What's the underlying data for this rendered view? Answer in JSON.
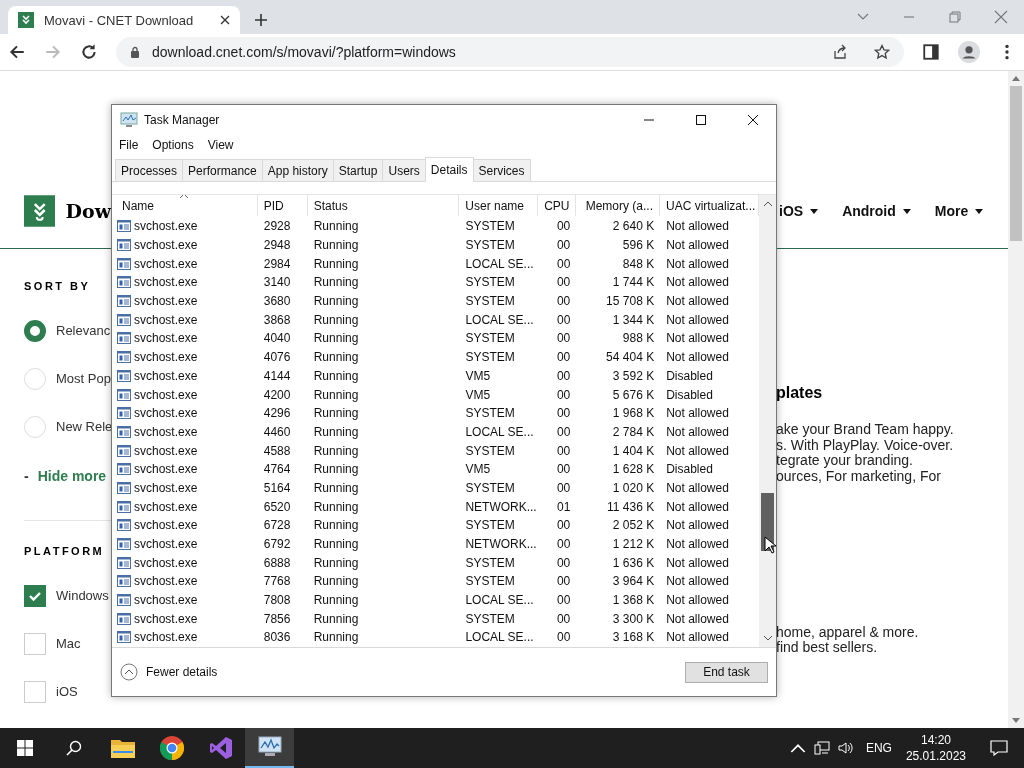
{
  "browser": {
    "tab": {
      "title": "Movavi - CNET Download"
    },
    "url": "download.cnet.com/s/movavi/?platform=windows"
  },
  "page": {
    "logo_text": "Dow",
    "nav": [
      "iOS",
      "Android",
      "More"
    ],
    "sort_by": {
      "heading": "SORT BY",
      "options": [
        {
          "label": "Relevanc",
          "selected": true
        },
        {
          "label": "Most Pop",
          "selected": false
        },
        {
          "label": "New Rele",
          "selected": false
        }
      ]
    },
    "toggle": {
      "sign": "-",
      "label": "Hide more"
    },
    "platform": {
      "heading": "PLATFORM",
      "options": [
        {
          "label": "Windows",
          "checked": true
        },
        {
          "label": "Mac",
          "checked": false
        },
        {
          "label": "iOS",
          "checked": false
        }
      ]
    },
    "promo_heading": "plates",
    "promo_lines": [
      "ake your Brand Team happy.",
      "s. With PlayPlay. Voice-over.",
      "tegrate your branding.",
      "ources, For marketing, For"
    ],
    "shop_lines": [
      "home, apparel & more.",
      "find best sellers."
    ]
  },
  "task_manager": {
    "title": "Task Manager",
    "menu": [
      "File",
      "Options",
      "View"
    ],
    "tabs": [
      {
        "label": "Processes",
        "selected": false
      },
      {
        "label": "Performance",
        "selected": false
      },
      {
        "label": "App history",
        "selected": false
      },
      {
        "label": "Startup",
        "selected": false
      },
      {
        "label": "Users",
        "selected": false
      },
      {
        "label": "Details",
        "selected": true
      },
      {
        "label": "Services",
        "selected": false
      }
    ],
    "columns": [
      "Name",
      "PID",
      "Status",
      "User name",
      "CPU",
      "Memory (a...",
      "UAC virtualizat..."
    ],
    "rows": [
      [
        "svchost.exe",
        "2928",
        "Running",
        "SYSTEM",
        "00",
        "2 640 K",
        "Not allowed"
      ],
      [
        "svchost.exe",
        "2948",
        "Running",
        "SYSTEM",
        "00",
        "596 K",
        "Not allowed"
      ],
      [
        "svchost.exe",
        "2984",
        "Running",
        "LOCAL SE...",
        "00",
        "848 K",
        "Not allowed"
      ],
      [
        "svchost.exe",
        "3140",
        "Running",
        "SYSTEM",
        "00",
        "1 744 K",
        "Not allowed"
      ],
      [
        "svchost.exe",
        "3680",
        "Running",
        "SYSTEM",
        "00",
        "15 708 K",
        "Not allowed"
      ],
      [
        "svchost.exe",
        "3868",
        "Running",
        "LOCAL SE...",
        "00",
        "1 344 K",
        "Not allowed"
      ],
      [
        "svchost.exe",
        "4040",
        "Running",
        "SYSTEM",
        "00",
        "988 K",
        "Not allowed"
      ],
      [
        "svchost.exe",
        "4076",
        "Running",
        "SYSTEM",
        "00",
        "54 404 K",
        "Not allowed"
      ],
      [
        "svchost.exe",
        "4144",
        "Running",
        "VM5",
        "00",
        "3 592 K",
        "Disabled"
      ],
      [
        "svchost.exe",
        "4200",
        "Running",
        "VM5",
        "00",
        "5 676 K",
        "Disabled"
      ],
      [
        "svchost.exe",
        "4296",
        "Running",
        "SYSTEM",
        "00",
        "1 968 K",
        "Not allowed"
      ],
      [
        "svchost.exe",
        "4460",
        "Running",
        "LOCAL SE...",
        "00",
        "2 784 K",
        "Not allowed"
      ],
      [
        "svchost.exe",
        "4588",
        "Running",
        "SYSTEM",
        "00",
        "1 404 K",
        "Not allowed"
      ],
      [
        "svchost.exe",
        "4764",
        "Running",
        "VM5",
        "00",
        "1 628 K",
        "Disabled"
      ],
      [
        "svchost.exe",
        "5164",
        "Running",
        "SYSTEM",
        "00",
        "1 020 K",
        "Not allowed"
      ],
      [
        "svchost.exe",
        "6520",
        "Running",
        "NETWORK...",
        "01",
        "11 436 K",
        "Not allowed"
      ],
      [
        "svchost.exe",
        "6728",
        "Running",
        "SYSTEM",
        "00",
        "2 052 K",
        "Not allowed"
      ],
      [
        "svchost.exe",
        "6792",
        "Running",
        "NETWORK...",
        "00",
        "1 212 K",
        "Not allowed"
      ],
      [
        "svchost.exe",
        "6888",
        "Running",
        "SYSTEM",
        "00",
        "1 636 K",
        "Not allowed"
      ],
      [
        "svchost.exe",
        "7768",
        "Running",
        "SYSTEM",
        "00",
        "3 964 K",
        "Not allowed"
      ],
      [
        "svchost.exe",
        "7808",
        "Running",
        "LOCAL SE...",
        "00",
        "1 368 K",
        "Not allowed"
      ],
      [
        "svchost.exe",
        "7856",
        "Running",
        "SYSTEM",
        "00",
        "3 300 K",
        "Not allowed"
      ],
      [
        "svchost.exe",
        "8036",
        "Running",
        "LOCAL SE...",
        "00",
        "3 168 K",
        "Not allowed"
      ]
    ],
    "fewer_details": "Fewer details",
    "end_task": "End task"
  },
  "taskbar": {
    "apps": [
      {
        "kind": "start",
        "active": false
      },
      {
        "kind": "search",
        "active": false
      },
      {
        "kind": "folder",
        "active": false
      },
      {
        "kind": "chrome",
        "active": false
      },
      {
        "kind": "studio",
        "active": false
      },
      {
        "kind": "monitor",
        "active": true
      }
    ],
    "language": "ENG",
    "time": "14:20",
    "date": "25.01.2023"
  }
}
